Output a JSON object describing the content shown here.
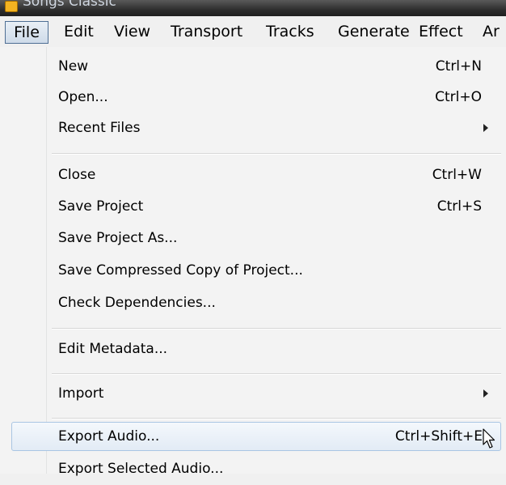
{
  "window": {
    "title": "Songs Classic",
    "icon": "audacity-app-icon"
  },
  "menubar": {
    "items": [
      "File",
      "Edit",
      "View",
      "Transport",
      "Tracks",
      "Generate",
      "Effect",
      "Ar"
    ],
    "active": "File"
  },
  "file_menu": {
    "items": [
      {
        "label": "New",
        "shortcut": "Ctrl+N"
      },
      {
        "label": "Open...",
        "shortcut": "Ctrl+O"
      },
      {
        "label": "Recent Files",
        "submenu": true
      },
      {
        "label": "Close",
        "shortcut": "Ctrl+W"
      },
      {
        "label": "Save Project",
        "shortcut": "Ctrl+S"
      },
      {
        "label": "Save Project As..."
      },
      {
        "label": "Save Compressed Copy of Project..."
      },
      {
        "label": "Check Dependencies..."
      },
      {
        "label": "Edit Metadata..."
      },
      {
        "label": "Import",
        "submenu": true
      },
      {
        "label": "Export Audio...",
        "shortcut": "Ctrl+Shift+E",
        "highlighted": true
      },
      {
        "label": "Export Selected Audio..."
      }
    ]
  },
  "colors": {
    "menu_background": "#f3f3f3",
    "highlight_border": "#a9c5e3",
    "active_menu_border": "#4f6f94"
  }
}
